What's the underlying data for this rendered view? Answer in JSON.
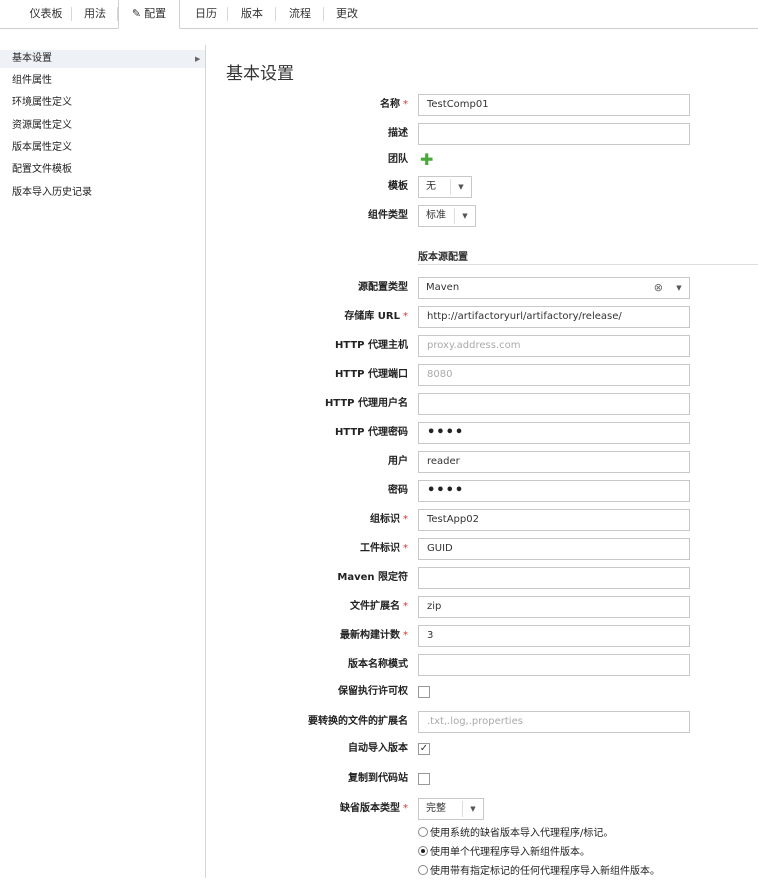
{
  "tabs": [
    "仪表板",
    "用法",
    "配置",
    "日历",
    "版本",
    "流程",
    "更改"
  ],
  "active_tab": "配置",
  "sidebar": {
    "items": [
      {
        "label": "基本设置"
      },
      {
        "label": "组件属性"
      },
      {
        "label": "环境属性定义"
      },
      {
        "label": "资源属性定义"
      },
      {
        "label": "版本属性定义"
      },
      {
        "label": "配置文件模板"
      },
      {
        "label": "版本导入历史记录"
      }
    ],
    "active": "基本设置"
  },
  "page_title": "基本设置",
  "form": {
    "name_label": "名称",
    "name_value": "TestComp01",
    "desc_label": "描述",
    "desc_value": "",
    "team_label": "团队",
    "template_label": "模板",
    "template_value": "无",
    "type_label": "组件类型",
    "type_value": "标准",
    "version_source_title": "版本源配置",
    "source_type_label": "源配置类型",
    "source_type_value": "Maven",
    "repo_url_label": "存储库 URL",
    "repo_url_value": "http://artifactoryurl/artifactory/release/",
    "proxy_host_label": "HTTP 代理主机",
    "proxy_host_placeholder": "proxy.address.com",
    "proxy_port_label": "HTTP 代理端口",
    "proxy_port_placeholder": "8080",
    "proxy_user_label": "HTTP 代理用户名",
    "proxy_user_value": "",
    "proxy_pass_label": "HTTP 代理密码",
    "proxy_pass_value": "••••",
    "user_label": "用户",
    "user_value": "reader",
    "pass_label": "密码",
    "pass_value": "••••",
    "group_id_label": "组标识",
    "group_id_value": "TestApp02",
    "artifact_id_label": "工件标识",
    "artifact_id_value": "GUID",
    "maven_qualifier_label": "Maven 限定符",
    "maven_qualifier_value": "",
    "file_ext_label": "文件扩展名",
    "file_ext_value": "zip",
    "latest_builds_label": "最新构建计数",
    "latest_builds_value": "3",
    "version_pattern_label": "版本名称模式",
    "version_pattern_value": "",
    "preserve_perm_label": "保留执行许可权",
    "preserve_perm_checked": false,
    "convert_ext_label": "要转换的文件的扩展名",
    "convert_ext_placeholder": ".txt,.log,.properties",
    "auto_import_label": "自动导入版本",
    "auto_import_checked": true,
    "copy_to_codestation_label": "复制到代码站",
    "copy_to_codestation_checked": false,
    "default_version_type_label": "缺省版本类型",
    "default_version_type_value": "完整",
    "radio_options": [
      {
        "label": "使用系统的缺省版本导入代理程序/标记。",
        "selected": false
      },
      {
        "label": "使用单个代理程序导入新组件版本。",
        "selected": true
      },
      {
        "label": "使用带有指定标记的任何代理程序导入新组件版本。",
        "selected": false
      }
    ]
  },
  "icons": {
    "edit": "pencil-icon",
    "add_team": "plus-icon",
    "clear": "clear-circle-icon",
    "dropdown": "caret-down-icon"
  },
  "colors": {
    "required": "#dd3333",
    "add": "#4aa83b",
    "sidebar_active_bg": "#eef1f5"
  }
}
